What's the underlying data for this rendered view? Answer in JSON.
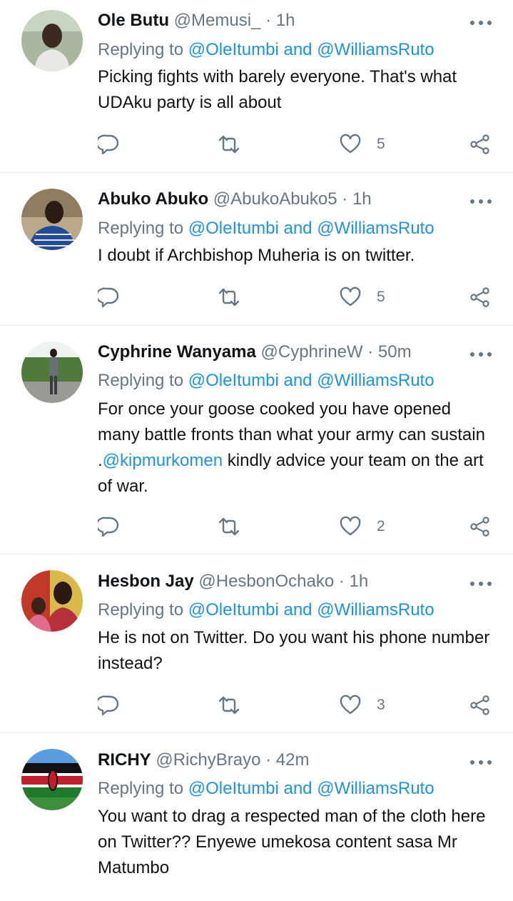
{
  "reply_prefix": "Replying to",
  "reply_mentions": "@OleItumbi and @WilliamsRuto",
  "colors": {
    "link": "#1b95e0",
    "secondary": "#657786",
    "text": "#0f1419",
    "divider": "#e6ecf0"
  },
  "icons": {
    "reply": "reply-icon",
    "retweet": "retweet-icon",
    "like": "heart-icon",
    "share": "share-icon",
    "more": "more-options-icon"
  },
  "tweets": [
    {
      "name": "Ole Butu",
      "handle": "@Memusi_",
      "time": "1h",
      "text_parts": [
        "Picking fights with barely everyone. That's what UDAku party is all about"
      ],
      "likes": "5"
    },
    {
      "name": "Abuko Abuko",
      "handle": "@AbukoAbuko5",
      "time": "1h",
      "text_parts": [
        "I doubt if Archbishop Muheria is on twitter."
      ],
      "likes": "5"
    },
    {
      "name": "Cyphrine Wanyama",
      "handle": "@CyphrineW",
      "time": "50m",
      "text_parts": [
        "For once your goose  cooked you have opened many battle fronts than what your army can sustain .",
        "@kipmurkomen",
        " kindly advice your team on the art of war."
      ],
      "likes": "2"
    },
    {
      "name": "Hesbon Jay",
      "handle": "@HesbonOchako",
      "time": "1h",
      "text_parts": [
        "He is not on Twitter. Do you want his phone number instead?"
      ],
      "likes": "3"
    },
    {
      "name": "RICHY",
      "handle": "@RichyBrayo",
      "time": "42m",
      "text_parts": [
        "You want to drag a respected man of the cloth here on Twitter?? Enyewe umekosa content sasa Mr Matumbo"
      ],
      "likes": ""
    }
  ]
}
